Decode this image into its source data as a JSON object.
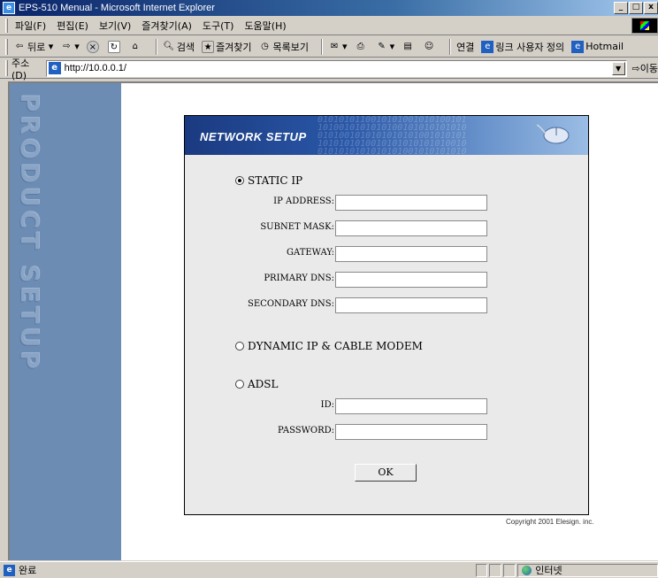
{
  "window": {
    "title": "EPS-510 Menual - Microsoft Internet Explorer",
    "buttons": {
      "minimize": "_",
      "maximize": "□",
      "close": "x"
    }
  },
  "menu": {
    "items": [
      "파일(F)",
      "편집(E)",
      "보기(V)",
      "즐겨찾기(A)",
      "도구(T)",
      "도움말(H)"
    ]
  },
  "toolbar": {
    "back": "뒤로",
    "search": "검색",
    "favorites": "즐겨찾기",
    "history": "목록보기",
    "links_label": "연결",
    "links": [
      "링크 사용자 정의",
      "Hotmail"
    ]
  },
  "address": {
    "label": "주소(D)",
    "url": "http://10.0.0.1/",
    "go": "이동"
  },
  "page": {
    "side_text": "PRODUCT SETUP",
    "panel_title": "NETWORK SETUP",
    "static_ip": {
      "label": "STATIC IP",
      "checked": true,
      "fields": [
        {
          "label": "IP ADDRESS:",
          "value": ""
        },
        {
          "label": "SUBNET MASK:",
          "value": ""
        },
        {
          "label": "GATEWAY:",
          "value": ""
        },
        {
          "label": "PRIMARY DNS:",
          "value": ""
        },
        {
          "label": "SECONDARY DNS:",
          "value": ""
        }
      ]
    },
    "dynamic_ip": {
      "label": "DYNAMIC IP & CABLE MODEM",
      "checked": false
    },
    "adsl": {
      "label": "ADSL",
      "checked": false,
      "fields": [
        {
          "label": "ID:",
          "value": ""
        },
        {
          "label": "PASSWORD:",
          "value": ""
        }
      ]
    },
    "ok_label": "OK",
    "copyright": "Copyright 2001 Elesign. inc."
  },
  "status": {
    "text": "완료",
    "zone": "인터넷"
  }
}
